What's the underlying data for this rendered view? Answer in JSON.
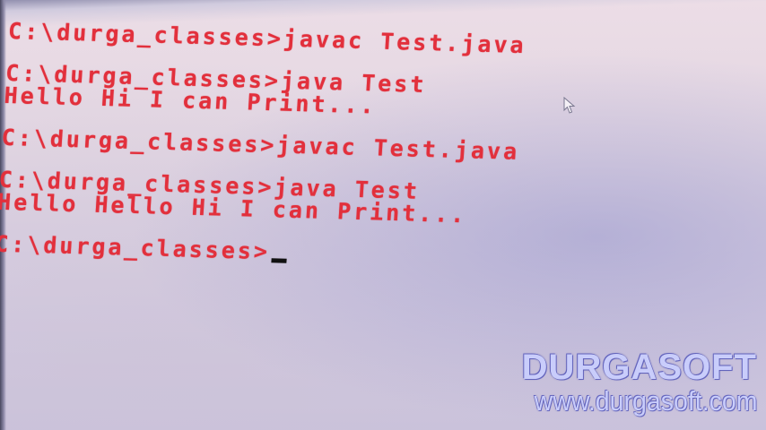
{
  "console": {
    "lines": [
      "C:\\durga_classes>javac Test.java",
      "",
      "C:\\durga_classes>java Test",
      "Hello Hi I can Print...",
      "",
      "C:\\durga_classes>javac Test.java",
      "",
      "C:\\durga_classes>java Test",
      "Hello Hello Hi I can Print...",
      "",
      "C:\\durga_classes>"
    ],
    "text_color": "#e2303c",
    "background_color": "#e6dae4"
  },
  "cursor_icon": "mouse-pointer-icon",
  "watermark": {
    "name": "DURGASOFT",
    "url": "www.durgasoft.com",
    "color": "#c9cdfb"
  }
}
